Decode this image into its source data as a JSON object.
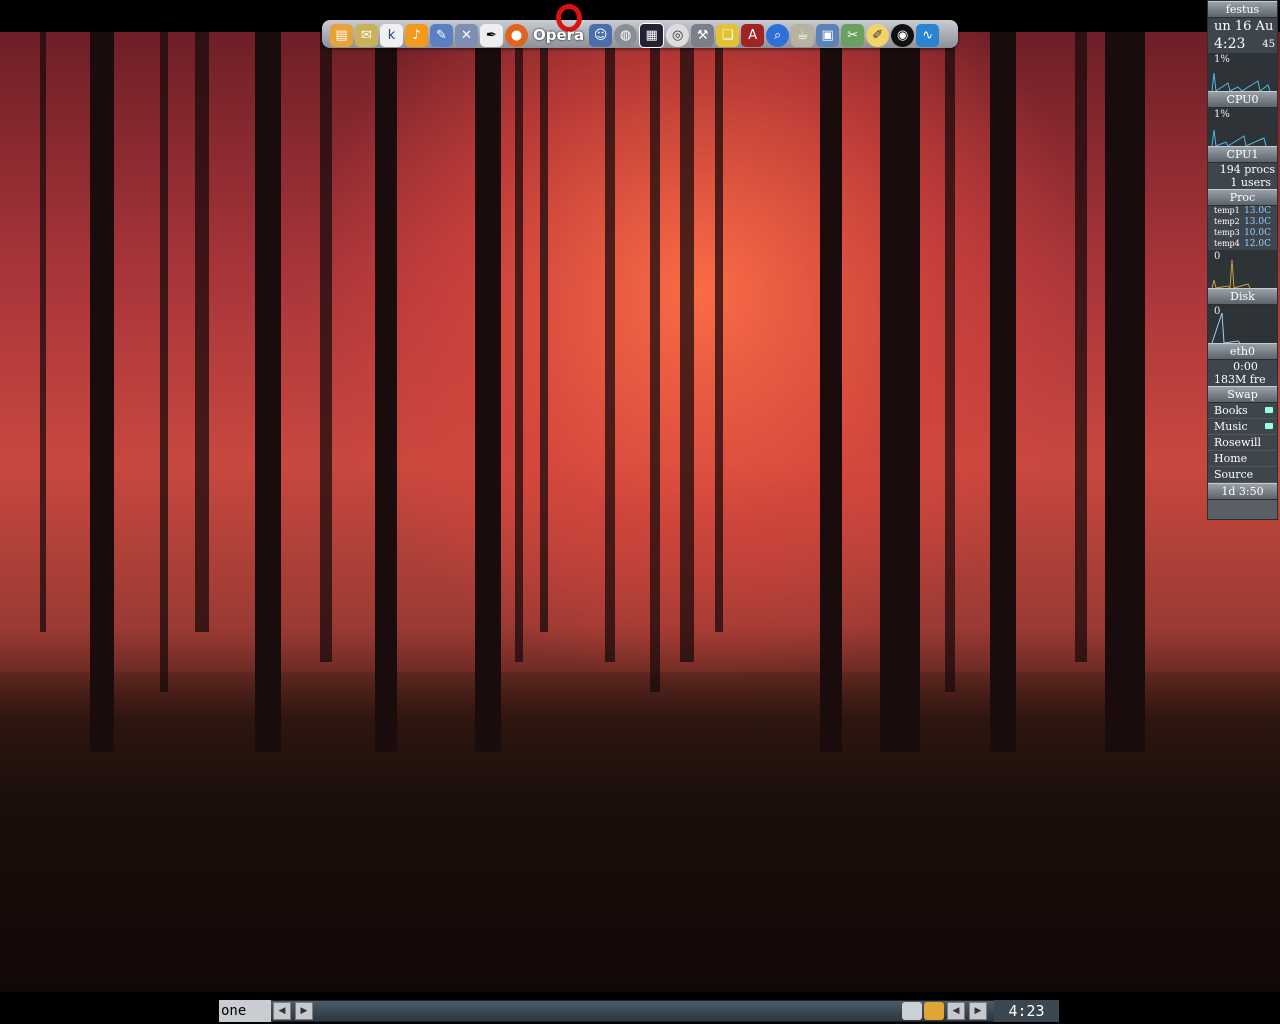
{
  "dock": {
    "opera_label": "Opera",
    "icons": [
      "files-icon",
      "mail-icon",
      "konqueror-icon",
      "amarok-icon",
      "tools-icon",
      "network-icon",
      "pen-icon",
      "firefox-icon",
      "opera-icon",
      "person-icon",
      "globe-icon",
      "photo-icon",
      "dvd-icon",
      "wrench-icon",
      "notes-icon",
      "dictionary-icon",
      "search-icon",
      "cup-icon",
      "image-viewer-icon",
      "tools2-icon",
      "pencil-icon",
      "trash-icon",
      "monitor-icon"
    ]
  },
  "gkrellm": {
    "hostname": "festus",
    "date": "un 16 Au",
    "time": "4:23",
    "seconds": "45",
    "cpu0_percent": "1%",
    "cpu0_label": "CPU0",
    "cpu1_percent": "1%",
    "cpu1_label": "CPU1",
    "procs": "194 procs",
    "users": "1 users",
    "proc_label": "Proc",
    "temps": [
      {
        "name": "temp1",
        "value": "13.0C"
      },
      {
        "name": "temp2",
        "value": "13.0C"
      },
      {
        "name": "temp3",
        "value": "10.0C"
      },
      {
        "name": "temp4",
        "value": "12.0C"
      }
    ],
    "disk_value": "0",
    "disk_label": "Disk",
    "net_value": "0",
    "net_label": "eth0",
    "net_time": "0:00",
    "swap_free": "183M fre",
    "swap_label": "Swap",
    "mounts": [
      "Books",
      "Music",
      "Rosewill",
      "Home",
      "Source"
    ],
    "uptime": "1d 3:50"
  },
  "taskbar": {
    "desktop_name": "one",
    "clock": "4:23"
  }
}
